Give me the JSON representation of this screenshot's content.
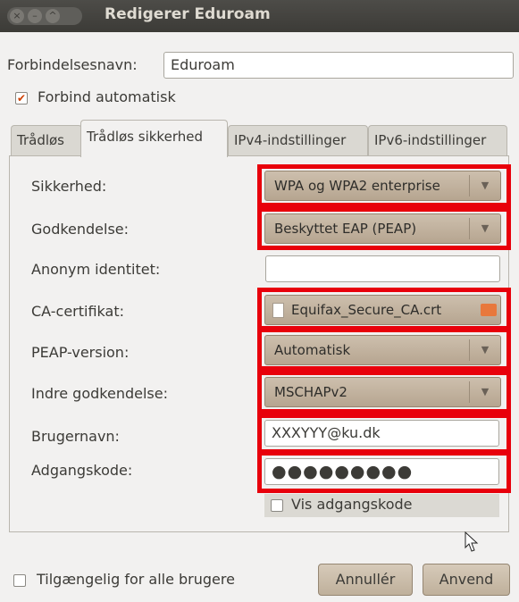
{
  "window": {
    "title": "Redigerer Eduroam",
    "btn_close": "×",
    "btn_min": "–",
    "btn_max": "^"
  },
  "connection_name": {
    "label": "Forbindelsesnavn:",
    "value": "Eduroam"
  },
  "auto_connect": {
    "label": "Forbind automatisk",
    "checked": true
  },
  "tabs": [
    {
      "label": "Trådløs"
    },
    {
      "label": "Trådløs sikkerhed"
    },
    {
      "label": "IPv4-indstillinger"
    },
    {
      "label": "IPv6-indstillinger"
    }
  ],
  "security": {
    "sikkerhed": {
      "label": "Sikkerhed:",
      "value": "WPA og WPA2 enterprise"
    },
    "godkendelse": {
      "label": "Godkendelse:",
      "value": "Beskyttet EAP (PEAP)"
    },
    "anonym": {
      "label": "Anonym identitet:",
      "value": ""
    },
    "ca_cert": {
      "label": "CA-certifikat:",
      "value": "Equifax_Secure_CA.crt"
    },
    "peap": {
      "label": "PEAP-version:",
      "value": "Automatisk"
    },
    "indre": {
      "label": "Indre godkendelse:",
      "value": "MSCHAPv2"
    },
    "brugernavn": {
      "label": "Brugernavn:",
      "value": "XXXYYY@ku.dk"
    },
    "adgangskode": {
      "label": "Adgangskode:",
      "value": "●●●●●●●●●"
    },
    "vis": {
      "label": "Vis adgangskode",
      "checked": false
    }
  },
  "all_users": {
    "label": "Tilgængelig for alle brugere",
    "checked": false
  },
  "buttons": {
    "cancel": "Annullér",
    "apply": "Anvend"
  },
  "icons": {
    "combo_arrow": "▼",
    "check_mark": "✔",
    "file_icon": "file-icon",
    "folder_icon": "folder-icon"
  },
  "colors": {
    "highlight": "#e8000b",
    "titlebar": "#3c3b37",
    "combo": "#c2b29f"
  }
}
